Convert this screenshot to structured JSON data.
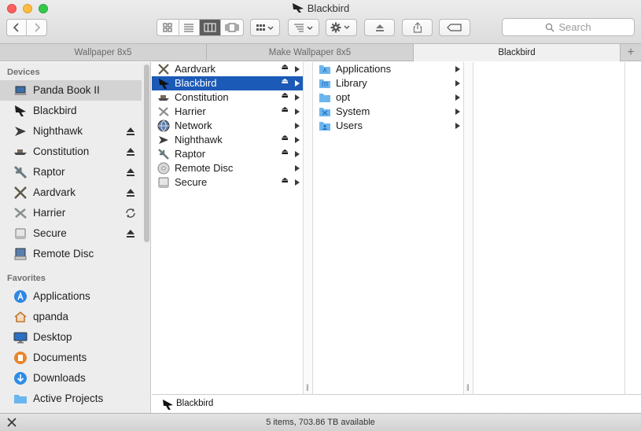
{
  "window": {
    "title": "Blackbird",
    "title_icon": "jet-icon"
  },
  "toolbar": {
    "back_icon": "chevron-left-icon",
    "forward_icon": "chevron-right-icon",
    "view_modes": [
      "icon-view-icon",
      "list-view-icon",
      "column-view-icon",
      "coverflow-view-icon"
    ],
    "active_view": "column-view-icon",
    "arrange_icon": "grid-arrange-icon",
    "sort_icon": "sort-list-icon",
    "action_icon": "gear-icon",
    "eject_icon": "eject-icon",
    "share_icon": "share-icon",
    "tag_icon": "tag-icon",
    "search_placeholder": "Search"
  },
  "tabs": [
    {
      "label": "Wallpaper 8x5"
    },
    {
      "label": "Make Wallpaper 8x5"
    },
    {
      "label": "Blackbird"
    }
  ],
  "tab_add": "+",
  "sidebar": {
    "devices_heading": "Devices",
    "devices": [
      {
        "label": "Panda Book II",
        "icon": "laptop-icon"
      },
      {
        "label": "Blackbird",
        "icon": "jet-icon"
      },
      {
        "label": "Nighthawk",
        "icon": "jet-icon",
        "action": "eject"
      },
      {
        "label": "Constitution",
        "icon": "ship-icon",
        "action": "eject"
      },
      {
        "label": "Raptor",
        "icon": "jet-icon",
        "action": "eject"
      },
      {
        "label": "Aardvark",
        "icon": "jet-icon",
        "action": "eject"
      },
      {
        "label": "Harrier",
        "icon": "jet-icon",
        "action": "sync"
      },
      {
        "label": "Secure",
        "icon": "drive-icon",
        "action": "eject"
      },
      {
        "label": "Remote Disc",
        "icon": "remote-disc-icon"
      }
    ],
    "favorites_heading": "Favorites",
    "favorites": [
      {
        "label": "Applications",
        "icon": "applications-icon"
      },
      {
        "label": "qpanda",
        "icon": "home-icon"
      },
      {
        "label": "Desktop",
        "icon": "desktop-icon"
      },
      {
        "label": "Documents",
        "icon": "documents-icon"
      },
      {
        "label": "Downloads",
        "icon": "downloads-icon"
      },
      {
        "label": "Active Projects",
        "icon": "folder-icon"
      }
    ]
  },
  "columns": {
    "col1": [
      {
        "label": "Aardvark",
        "icon": "jet-icon",
        "eject": "⏏"
      },
      {
        "label": "Blackbird",
        "icon": "jet-icon",
        "eject": "⏏"
      },
      {
        "label": "Constitution",
        "icon": "ship-icon",
        "eject": "⏏"
      },
      {
        "label": "Harrier",
        "icon": "jet-icon",
        "eject": "⏏"
      },
      {
        "label": "Network",
        "icon": "network-icon"
      },
      {
        "label": "Nighthawk",
        "icon": "jet-icon",
        "eject": "⏏"
      },
      {
        "label": "Raptor",
        "icon": "jet-icon",
        "eject": "⏏"
      },
      {
        "label": "Remote Disc",
        "icon": "remote-disc-icon"
      },
      {
        "label": "Secure",
        "icon": "drive-icon",
        "eject": "⏏"
      }
    ],
    "col2": [
      {
        "label": "Applications",
        "icon": "applications-folder-icon"
      },
      {
        "label": "Library",
        "icon": "library-folder-icon"
      },
      {
        "label": "opt",
        "icon": "folder-icon"
      },
      {
        "label": "System",
        "icon": "system-folder-icon"
      },
      {
        "label": "Users",
        "icon": "users-folder-icon"
      }
    ]
  },
  "pathbar": {
    "label": "Blackbird",
    "icon": "jet-icon"
  },
  "status": {
    "text": "5 items, 703.86 TB available",
    "icon": "tools-icon"
  }
}
